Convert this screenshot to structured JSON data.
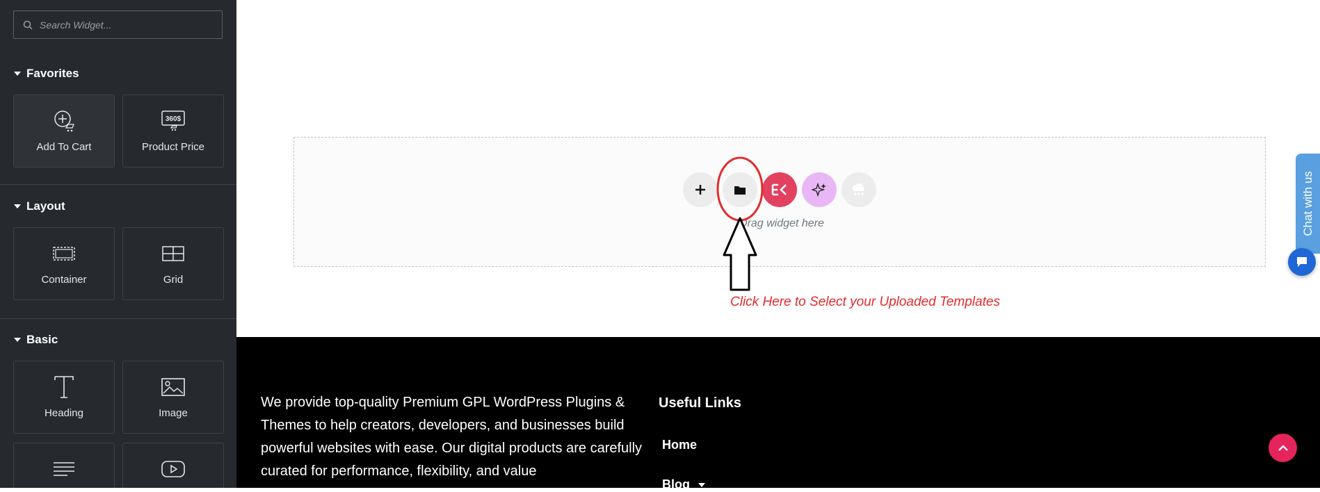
{
  "sidebar": {
    "search": {
      "placeholder": "Search Widget..."
    },
    "categories": [
      {
        "title": "Favorites",
        "widgets": [
          {
            "label": "Add To Cart",
            "icon": "add-to-cart-icon"
          },
          {
            "label": "Product Price",
            "icon": "product-price-icon"
          }
        ]
      },
      {
        "title": "Layout",
        "widgets": [
          {
            "label": "Container",
            "icon": "container-icon"
          },
          {
            "label": "Grid",
            "icon": "grid-icon"
          }
        ]
      },
      {
        "title": "Basic",
        "widgets": [
          {
            "label": "Heading",
            "icon": "heading-icon"
          },
          {
            "label": "Image",
            "icon": "image-icon"
          }
        ]
      }
    ],
    "product_price_icon_text": "360$"
  },
  "canvas": {
    "drag_text": "Drag widget here",
    "annotation": "Click Here to Select your Uploaded Templates",
    "toolbar": [
      "add-section",
      "template-library",
      "elementskit",
      "ai-assistant",
      "cloud-library"
    ]
  },
  "footer": {
    "description": "We provide top-quality Premium GPL WordPress Plugins & Themes to help creators, developers, and businesses build powerful websites with ease. Our digital products are carefully curated for performance, flexibility, and value",
    "useful_links_title": "Useful Links",
    "links": [
      "Home",
      "Blog"
    ]
  },
  "chat": {
    "label": "Chat with us"
  },
  "colors": {
    "sidebar_bg": "#26292d",
    "accent_red": "#e22b2b",
    "brand_pink": "#e4245a",
    "ai_purple": "#e9b7f5",
    "chat_blue": "#5aa0e0"
  }
}
